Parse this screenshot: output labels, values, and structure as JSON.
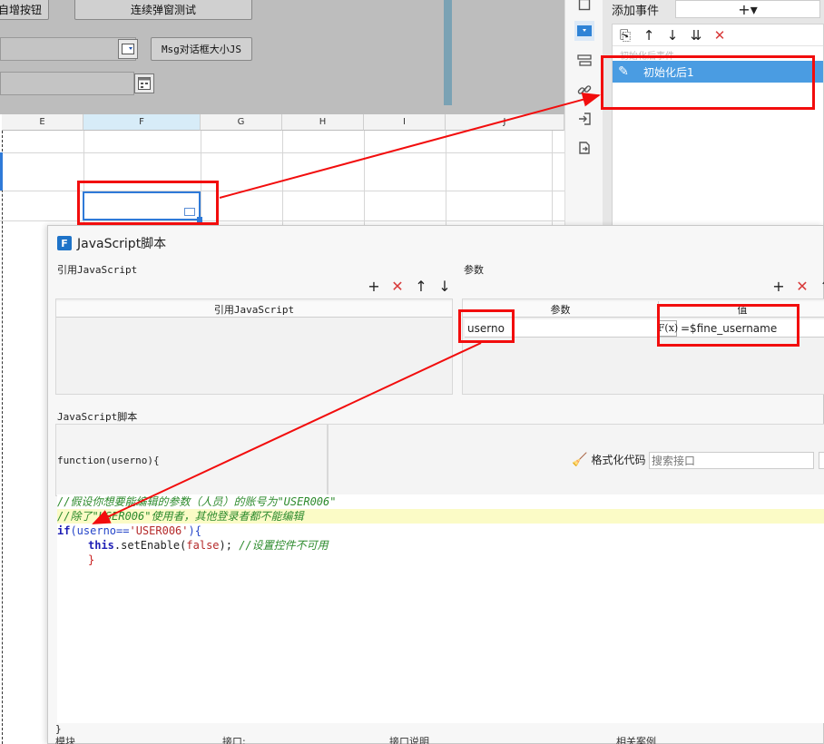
{
  "form": {
    "btn_add_partial": "自增按钮",
    "btn_popup_test": "连续弹窗测试",
    "btn_msg_size": "Msg对话框大小JS"
  },
  "sheet": {
    "columns": [
      "E",
      "F",
      "G",
      "H",
      "I",
      "J"
    ],
    "active_column": "F"
  },
  "events": {
    "add_event_label": "添加事件",
    "add_symbol": "+▾",
    "group_label": "初始化后事件",
    "item_label": "初始化后1",
    "toolbar": [
      "copy-icon",
      "arrow-up-icon",
      "arrow-down-icon",
      "move-bottom-icon",
      "delete-icon"
    ]
  },
  "dialog": {
    "title": "JavaScript脚本",
    "ref_js_label": "引用JavaScript",
    "params_label": "参数",
    "ref_js_column": "引用JavaScript",
    "param_column": "参数",
    "value_column": "值",
    "param_name": "userno",
    "fx_label": "F(x)",
    "param_value": "=$fine_username",
    "script_label": "JavaScript脚本",
    "func_signature": "function(userno){",
    "format_code_label": "格式化代码",
    "search_placeholder": "搜索接口",
    "closing_brace": "}",
    "footer": [
      "模块",
      "接口:",
      "接口说明",
      "相关案例"
    ]
  },
  "code": {
    "line1": "//假设你想要能编辑的参数（人员）的账号为\"USER006\"",
    "line2": "//除了\"USER006\"使用者，其他登录者都不能编辑",
    "line3_kw": "if",
    "line3_a": "(userno==",
    "line3_str": "'USER006'",
    "line3_b": "){",
    "line4_kw": "this",
    "line4_call": ".setEnable(",
    "line4_false": "false",
    "line4_end": ");",
    "line4_comment": "//设置控件不可用",
    "line5": "}"
  },
  "colors": {
    "annotation_red": "#f20d0d",
    "selection_blue": "#4a9ce2"
  }
}
